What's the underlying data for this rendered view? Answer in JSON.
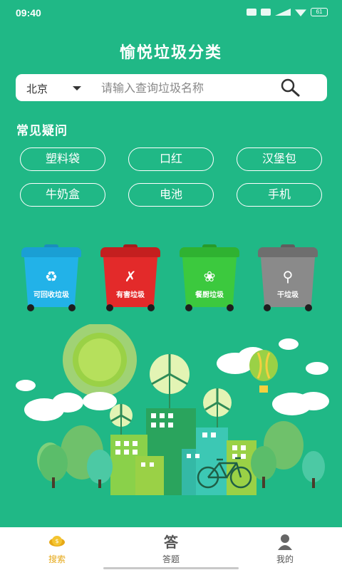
{
  "status": {
    "time": "09:40",
    "battery": "61"
  },
  "app_title": "愉悦垃圾分类",
  "search": {
    "city": "北京",
    "placeholder": "请输入查询垃圾名称"
  },
  "faq": {
    "title": "常见疑问",
    "items": [
      "塑料袋",
      "口红",
      "汉堡包",
      "牛奶盒",
      "电池",
      "手机"
    ]
  },
  "bins": [
    {
      "label": "可回收垃圾",
      "color": "#22b2e8",
      "icon": "recycle-icon"
    },
    {
      "label": "有害垃圾",
      "color": "#e32a2a",
      "icon": "hazard-icon"
    },
    {
      "label": "餐厨垃圾",
      "color": "#3cc93e",
      "icon": "food-waste-icon"
    },
    {
      "label": "干垃圾",
      "color": "#8a8a8a",
      "icon": "dry-waste-icon"
    }
  ],
  "tabs": [
    {
      "label": "搜索",
      "icon": "search-tab-icon",
      "active": true
    },
    {
      "label": "答题",
      "icon": "quiz-tab-icon",
      "active": false
    },
    {
      "label": "我的",
      "icon": "profile-tab-icon",
      "active": false
    }
  ],
  "colors": {
    "primary": "#20b886",
    "tab_active": "#e6a817"
  }
}
